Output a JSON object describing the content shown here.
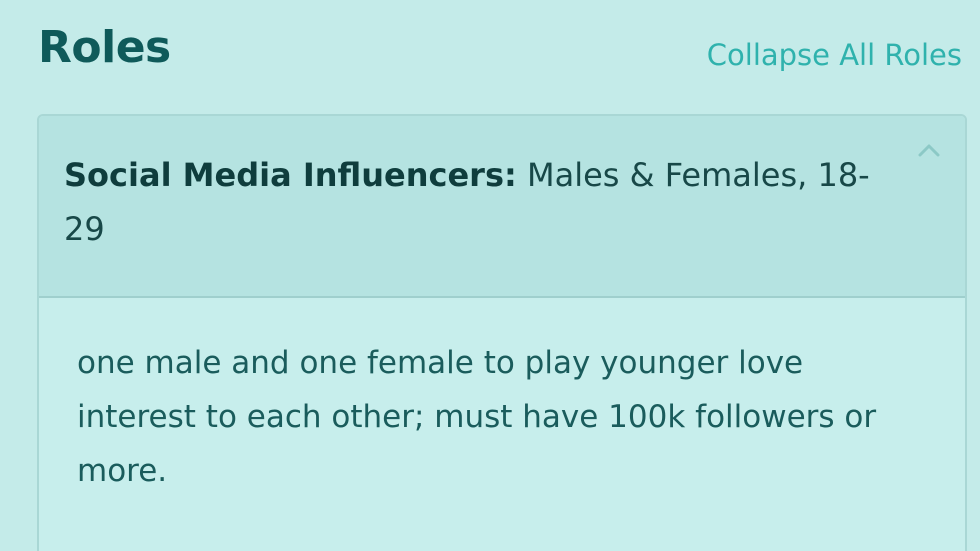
{
  "section": {
    "title": "Roles",
    "collapse_label": "Collapse All Roles"
  },
  "role": {
    "name": "Social Media Influencers:",
    "details": " Males & Females, 18-29",
    "description": "one male and one female to play younger love interest to each other; must have 100k followers or more."
  },
  "icons": {
    "toggle": "chevron-up-icon"
  },
  "colors": {
    "background": "#c4ebe9",
    "title": "#0f5a5a",
    "link": "#2fb2ad",
    "card_header": "#b5e3e1"
  }
}
